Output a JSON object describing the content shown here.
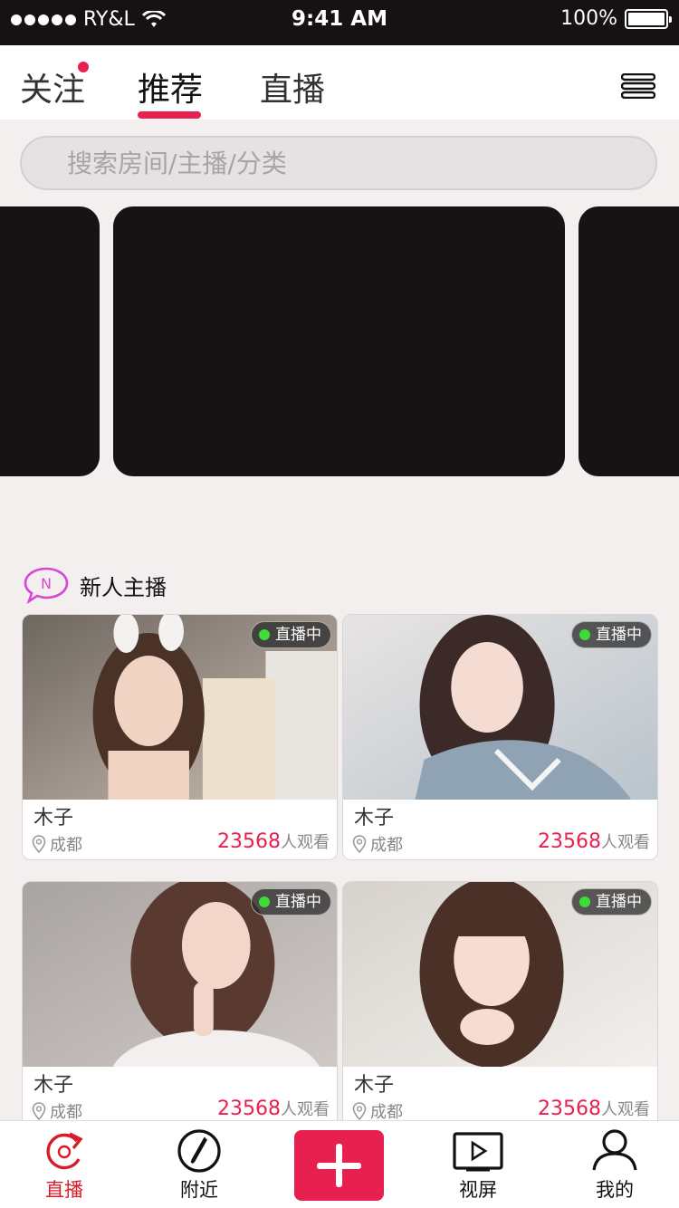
{
  "status_bar": {
    "carrier": "RY&L",
    "time": "9:41 AM",
    "battery": "100%"
  },
  "top_nav": {
    "tabs": [
      {
        "label": "关注",
        "has_dot": true
      },
      {
        "label": "推荐",
        "active": true
      },
      {
        "label": "直播"
      }
    ]
  },
  "search": {
    "placeholder": "搜索房间/主播/分类"
  },
  "section": {
    "badge_letter": "N",
    "title": "新人主播"
  },
  "cards": [
    {
      "badge": "直播中",
      "name": "木子",
      "location": "成都",
      "viewers_count": "23568",
      "viewers_suffix": "人观看"
    },
    {
      "badge": "直播中",
      "name": "木子",
      "location": "成都",
      "viewers_count": "23568",
      "viewers_suffix": "人观看"
    },
    {
      "badge": "直播中",
      "name": "木子",
      "location": "成都",
      "viewers_count": "23568",
      "viewers_suffix": "人观看"
    },
    {
      "badge": "直播中",
      "name": "木子",
      "location": "成都",
      "viewers_count": "23568",
      "viewers_suffix": "人观看"
    }
  ],
  "tab_bar": {
    "items": [
      {
        "label": "直播",
        "icon": "live-refresh-icon",
        "active": true
      },
      {
        "label": "附近",
        "icon": "compass-icon"
      },
      {
        "label": "",
        "icon": "plus-icon"
      },
      {
        "label": "视屏",
        "icon": "video-play-icon"
      },
      {
        "label": "我的",
        "icon": "user-icon"
      }
    ]
  },
  "colors": {
    "accent": "#e8204f",
    "live_dot": "#3ddc37",
    "banner": "#171314",
    "background": "#f4efef"
  }
}
